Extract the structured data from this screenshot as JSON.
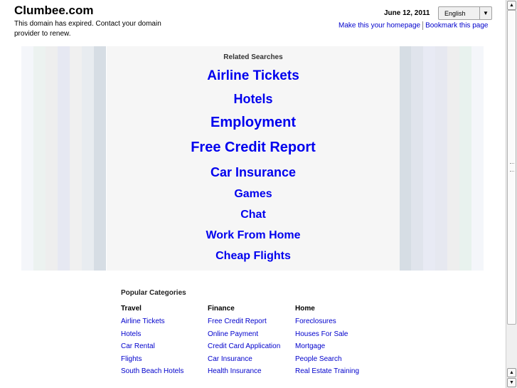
{
  "header": {
    "site_title": "Clumbee.com",
    "expired_notice": "This domain has expired. Contact your domain provider to renew.",
    "date": "June 12, 2011",
    "language_selected": "English",
    "homepage_link": "Make this your homepage",
    "bookmark_link": "Bookmark this page"
  },
  "related": {
    "title": "Related Searches",
    "links": [
      "Airline Tickets",
      "Hotels",
      "Employment",
      "Free Credit Report",
      "Car Insurance",
      "Games",
      "Chat",
      "Work From Home",
      "Cheap Flights"
    ]
  },
  "categories": {
    "title": "Popular Categories",
    "columns": [
      {
        "heading": "Travel",
        "items": [
          "Airline Tickets",
          "Hotels",
          "Car Rental",
          "Flights",
          "South Beach Hotels"
        ]
      },
      {
        "heading": "Finance",
        "items": [
          "Free Credit Report",
          "Online Payment",
          "Credit Card Application",
          "Car Insurance",
          "Health Insurance"
        ]
      },
      {
        "heading": "Home",
        "items": [
          "Foreclosures",
          "Houses For Sale",
          "Mortgage",
          "People Search",
          "Real Estate Training"
        ]
      }
    ]
  },
  "colors": {
    "link": "#0000ee",
    "panel": "#f6f6f6",
    "stripes_left": [
      "#f4f6fa",
      "#ecf2f0",
      "#eeeeee",
      "#e6e8f2",
      "#f0f0f0",
      "#e8ecf0",
      "#d6dde4"
    ],
    "stripes_right": [
      "#d6dde4",
      "#e0e4ec",
      "#e8eaf4",
      "#e6e8f0",
      "#eeeeee",
      "#e8f2ee",
      "#f4f6fa"
    ]
  },
  "icons": {
    "dropdown": "chevron-down-icon",
    "scroll_up": "arrow-up-icon",
    "scroll_down": "arrow-down-icon"
  }
}
